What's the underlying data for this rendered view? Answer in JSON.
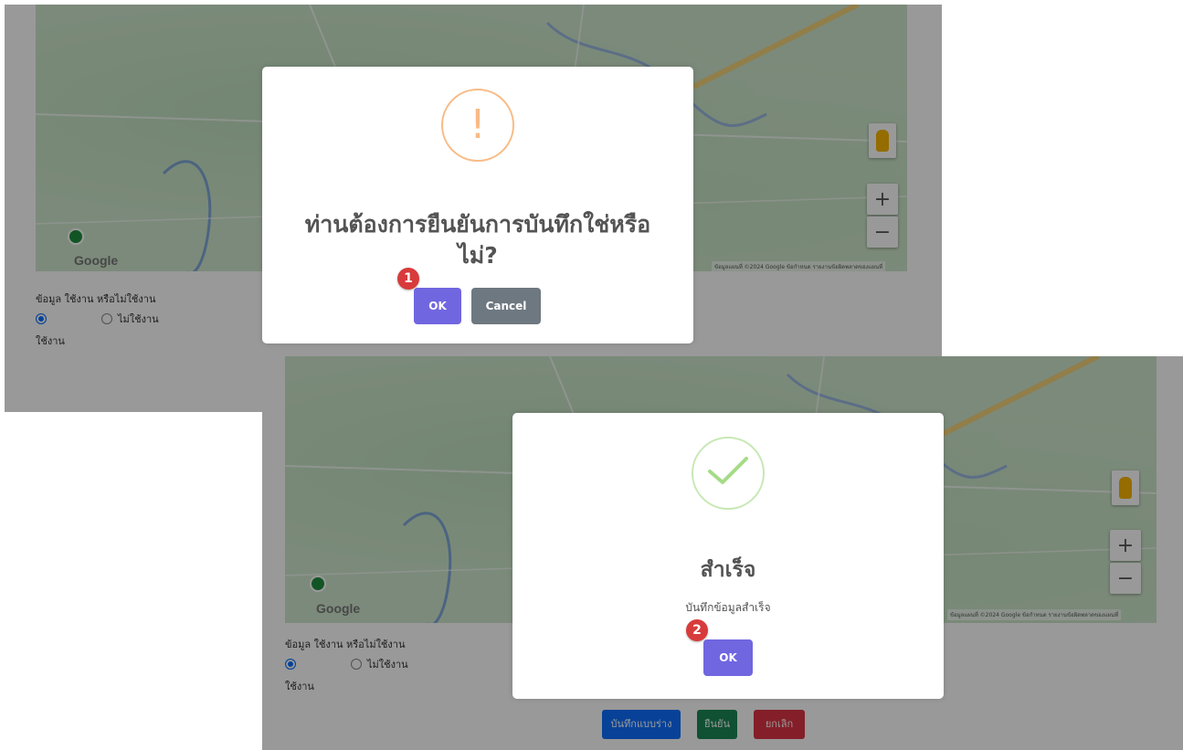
{
  "screen1": {
    "form": {
      "label": "ข้อมูล ใช้งาน หรือไม่ใช้งาน",
      "option_active": "ใช้งาน",
      "option_inactive": "ไม่ใช้งาน"
    },
    "map": {
      "google_logo": "Google",
      "footer": "ข้อมูลแผนที่ ©2024 Google  ข้อกำหนด  รายงานข้อผิดพลาดของแผนที่",
      "zoom_in": "+",
      "zoom_out": "−"
    },
    "dialog": {
      "icon": "warning-exclamation-icon",
      "icon_glyph": "!",
      "title": "ท่านต้องการยืนยันการบันทึกใช่หรือไม่?",
      "confirm_label": "OK",
      "cancel_label": "Cancel",
      "step_number": "1"
    }
  },
  "screen2": {
    "form": {
      "label": "ข้อมูล ใช้งาน หรือไม่ใช้งาน",
      "option_active": "ใช้งาน",
      "option_inactive": "ไม่ใช้งาน"
    },
    "map": {
      "google_logo": "Google",
      "footer": "ข้อมูลแผนที่ ©2024 Google  ข้อกำหนด  รายงานข้อผิดพลาดของแผนที่",
      "zoom_in": "+",
      "zoom_out": "−"
    },
    "actions": {
      "draft_label": "บันทึกแบบร่าง",
      "confirm_label": "ยืนยัน",
      "cancel_label": "ยกเลิก"
    },
    "dialog": {
      "icon": "success-check-icon",
      "title": "สำเร็จ",
      "text": "บันทึกข้อมูลสำเร็จ",
      "confirm_label": "OK",
      "step_number": "2"
    }
  },
  "colors": {
    "confirm_button": "#7066e0",
    "cancel_button": "#6e7881",
    "warning_icon": "#f8bb86",
    "success_icon": "#a5dc86",
    "step_badge": "#d83b3b"
  }
}
